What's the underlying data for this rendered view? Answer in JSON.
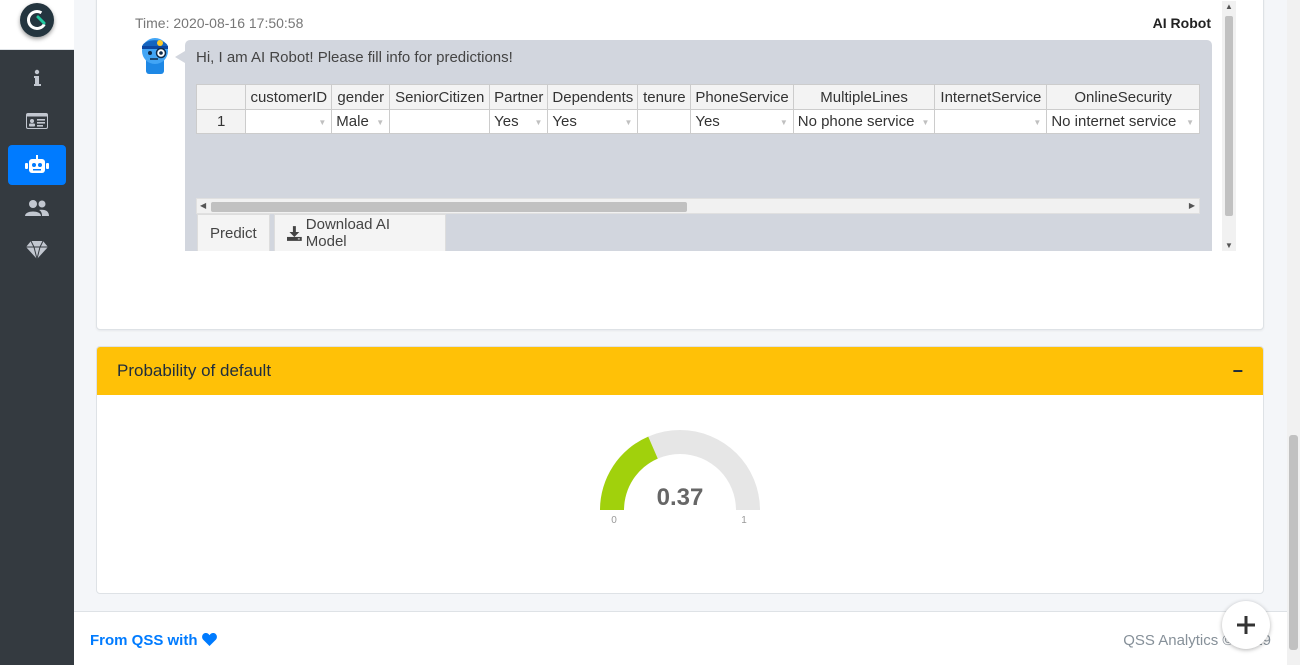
{
  "sidebar": {
    "logo_icon": "qss-logo-icon",
    "items": [
      {
        "name": "info",
        "icon": "info-icon",
        "active": false
      },
      {
        "name": "profile",
        "icon": "id-card-icon",
        "active": false
      },
      {
        "name": "ai-robot",
        "icon": "robot-icon",
        "active": true
      },
      {
        "name": "users",
        "icon": "users-icon",
        "active": false
      },
      {
        "name": "premium",
        "icon": "gem-icon",
        "active": false
      }
    ]
  },
  "chat": {
    "time": "Time: 2020-08-16 17:50:58",
    "sender": "AI Robot",
    "message": "Hi, I am AI Robot! Please fill info for predictions!",
    "table": {
      "columns": [
        "customerID",
        "gender",
        "SeniorCitizen",
        "Partner",
        "Dependents",
        "tenure",
        "PhoneService",
        "MultipleLines",
        "InternetService",
        "OnlineSecurity"
      ],
      "rows": [
        {
          "row": "1",
          "cells": [
            "",
            "Male",
            "",
            "Yes",
            "Yes",
            "",
            "Yes",
            "No phone service",
            "",
            "No internet service"
          ]
        }
      ]
    },
    "predict_label": "Predict",
    "download_label": "Download AI Model"
  },
  "gauge": {
    "title": "Probability of default",
    "value": 0.37,
    "value_text": "0.37",
    "min": "0",
    "max": "1",
    "fill_color": "#a1d10c",
    "track_color": "#e6e6e6"
  },
  "footer": {
    "left": "From QSS with",
    "heart_icon": "heart-icon",
    "right": "QSS Analytics © 2019"
  },
  "colors": {
    "primary": "#007bff",
    "warning": "#ffc107",
    "sidebar": "#343a40"
  }
}
